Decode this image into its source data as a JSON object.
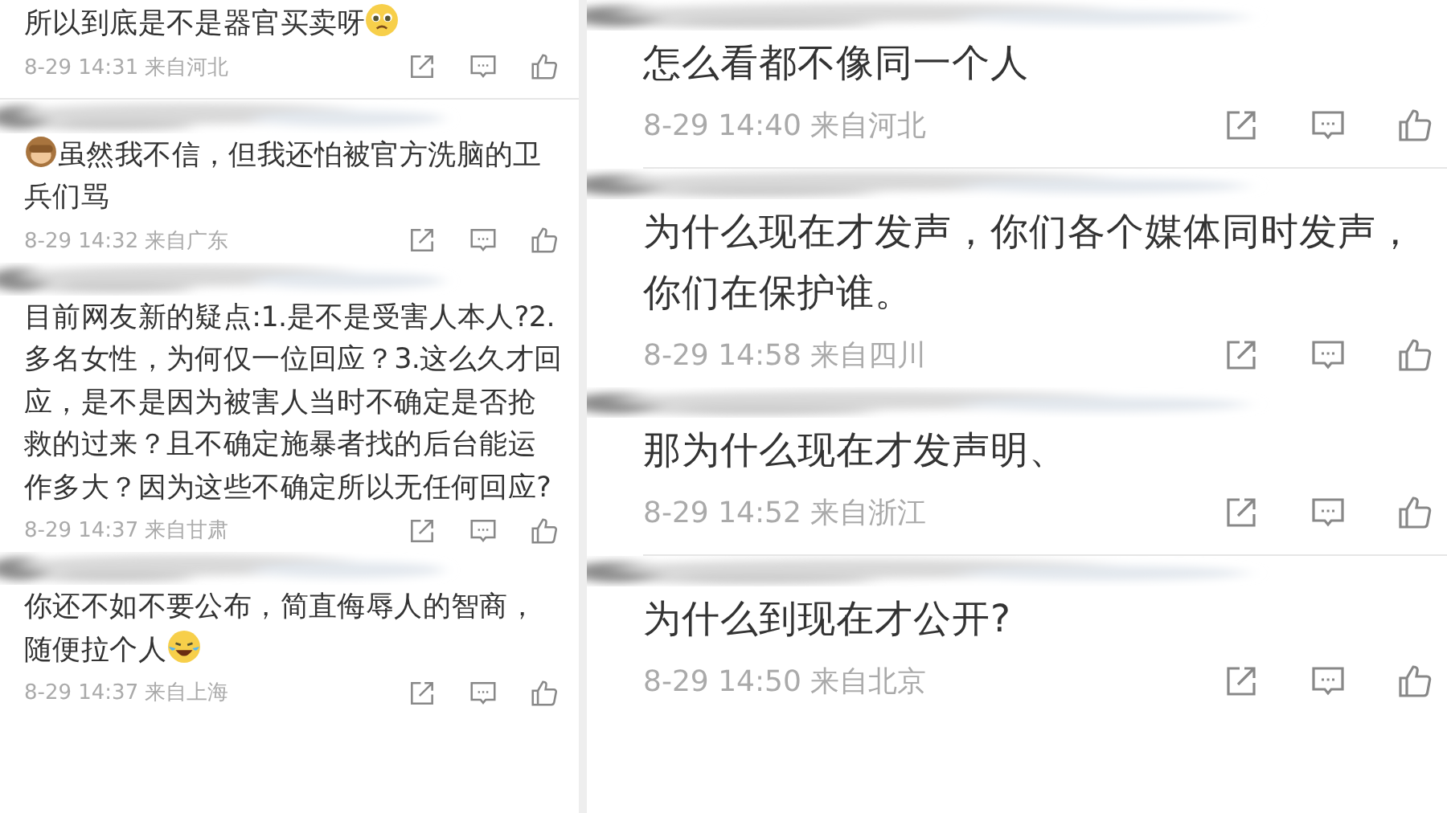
{
  "columns": [
    {
      "comments": [
        {
          "redacted_header": false,
          "text": "所以到底是不是器官买卖呀",
          "trailing_emoji": {
            "kind": "pleading"
          },
          "meta": "8-29 14:31 来自河北",
          "divider": true
        },
        {
          "redacted_header": true,
          "text": "虽然我不信，但我还怕被官方洗脑的卫兵们骂",
          "leading_emoji": {
            "kind": "monkey"
          },
          "meta": "8-29 14:32 来自广东",
          "divider": false
        },
        {
          "redacted_header": true,
          "text": "目前网友新的疑点:1.是不是受害人本人?2.多名女性，为何仅一位回应？3.这么久才回应，是不是因为被害人当时不确定是否抢救的过来？且不确定施暴者找的后台能运作多大？因为这些不确定所以无任何回应?",
          "meta": "8-29 14:37 来自甘肃",
          "divider": false
        },
        {
          "redacted_header": true,
          "text": "你还不如不要公布，简直侮辱人的智商，随便拉个人",
          "trailing_emoji": {
            "kind": "laughing"
          },
          "meta": "8-29 14:37 来自上海",
          "divider": false
        }
      ]
    },
    {
      "comments": [
        {
          "redacted_header": true,
          "text": "怎么看都不像同一个人",
          "meta": "8-29 14:40 来自河北",
          "divider": true
        },
        {
          "redacted_header": true,
          "text": "为什么现在才发声，你们各个媒体同时发声，你们在保护谁。",
          "meta": "8-29 14:58 来自四川",
          "divider": false
        },
        {
          "redacted_header": true,
          "text": "那为什么现在才发声明、",
          "meta": "8-29 14:52 来自浙江",
          "divider": true
        },
        {
          "redacted_header": true,
          "text": "为什么到现在才公开?",
          "meta": "8-29 14:50 来自北京",
          "divider": false
        }
      ]
    }
  ]
}
